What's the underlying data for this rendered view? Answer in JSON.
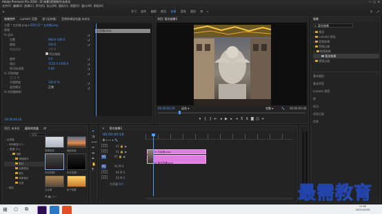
{
  "window": {
    "title": "Adobe Premiere Pro 2020 - D:\\电影\\视频制作\\未命名",
    "menu": [
      "文件(F)",
      "编辑(E)",
      "剪辑(C)",
      "序列(S)",
      "标记(M)",
      "图形(G)",
      "视图(V)",
      "窗口(W)",
      "帮助(H)"
    ]
  },
  "workspaces": [
    "学习",
    "组件",
    "编辑",
    "颜色",
    "效果",
    "音频",
    "图形",
    "库"
  ],
  "effect_controls": {
    "tabs": [
      "效果控件",
      "Lumetri 范围",
      "源:(无剪辑)",
      "音频剪辑混合器:未命名"
    ],
    "source_line": "主要 * 五台城.png",
    "clip_line": "序列 01 * 五台城.png",
    "header_video": "视频",
    "rows": [
      {
        "label": "fx 运动",
        "value": ""
      },
      {
        "label": "位置",
        "value": "960.0  540.0"
      },
      {
        "label": "缩放",
        "value": "100.0"
      },
      {
        "label": "缩放宽度",
        "value": "100.0"
      },
      {
        "label": "等比缩放",
        "value": ""
      },
      {
        "label": "旋转",
        "value": "0.0"
      },
      {
        "label": "锚点",
        "value": "1125.0  1500.0"
      },
      {
        "label": "防闪烁滤镜",
        "value": "0.00"
      },
      {
        "label": "fx 不透明度",
        "value": ""
      },
      {
        "label": "不透明度",
        "value": "100.0 %"
      },
      {
        "label": "混合模式",
        "value": "正常"
      },
      {
        "label": "fx 时间重映射",
        "value": ""
      }
    ],
    "mini_clip": "五台城.png",
    "timecode": "00:00:00:16"
  },
  "program": {
    "tab": "节目: 背光效果1",
    "timecode_left": "00:00:00:16",
    "fit": "适合",
    "quality": "完整",
    "timecode_right": "00:00:05:00"
  },
  "project": {
    "tabs": [
      "项目: 未命名",
      "媒体浏览器",
      "库"
    ],
    "search_placeholder": "搜索",
    "tree": [
      "此电脑",
      "本地磁盘 (C:)",
      "数据 (D:)",
      "电影",
      "视频制作",
      "素材",
      "效果预设",
      "图片",
      "背景音乐",
      "合成",
      "网络"
    ],
    "items": [
      {
        "name": "落雪视频"
      },
      {
        "name": "晚霞风景"
      },
      {
        "name": "背光效果1"
      },
      {
        "name": "背光效果2"
      },
      {
        "name": "五台城"
      },
      {
        "name": "影子效果"
      }
    ]
  },
  "timeline": {
    "tab": "背光效果1",
    "timecode": "00:00:00:16",
    "tracks_video": [
      "V3",
      "V2",
      "V1"
    ],
    "tracks_audio": [
      "A1",
      "A2",
      "A3"
    ],
    "master": "主声道",
    "master_value": "0.0",
    "clips": [
      {
        "name": "fx 五台城.png"
      },
      {
        "name": "fx 背光效果.png"
      }
    ]
  },
  "effects": {
    "title": "效果",
    "search_value": "背光效果",
    "groups": [
      "预设",
      "Lumetri 预设",
      "音频效果",
      "音频过渡",
      "视频效果",
      "视频过渡"
    ],
    "selected": "背光效果",
    "panels": [
      "基本图形",
      "基本声音",
      "Lumetri 颜色",
      "库",
      "标记",
      "历史记录",
      "信息"
    ]
  },
  "watermark": "最需教育",
  "taskbar": {
    "time": "11:02",
    "date": "2021/10/20"
  },
  "colors": {
    "accent": "#4a9cff",
    "clip_pink": "#e07de0",
    "playhead": "#4a9cff"
  }
}
